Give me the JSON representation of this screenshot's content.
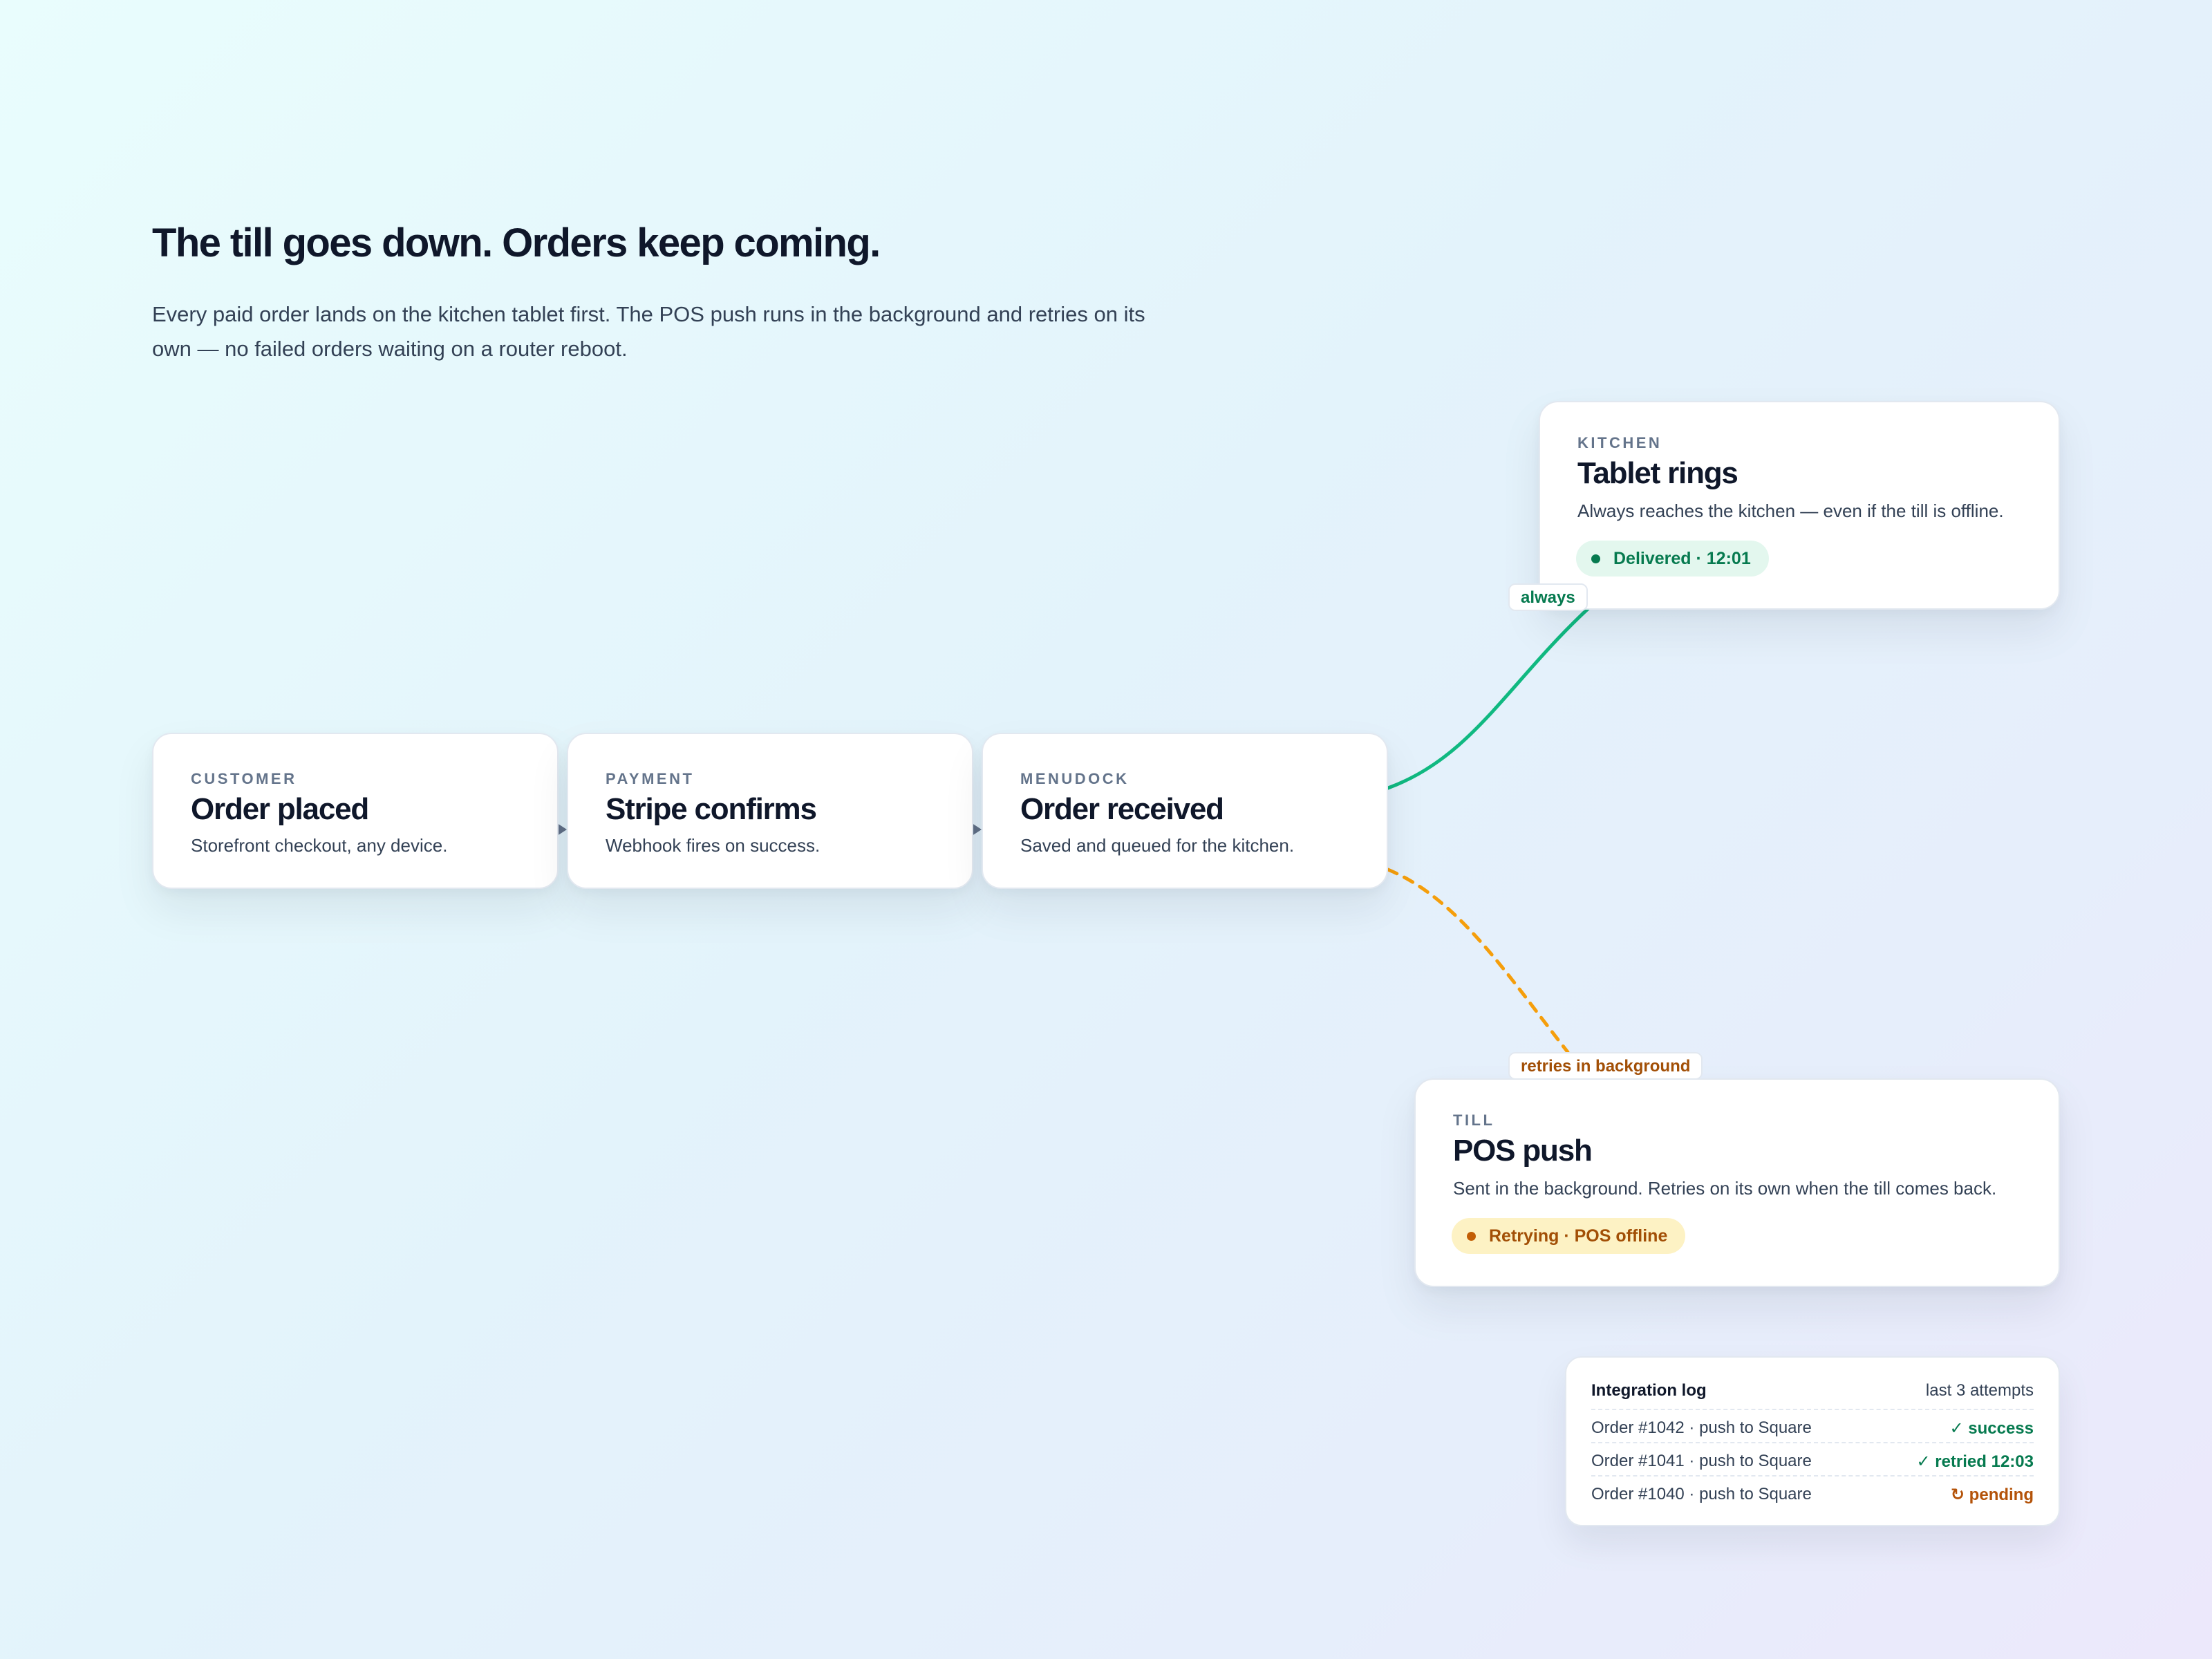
{
  "hero": {
    "headline": "The till goes down. Orders keep coming.",
    "subtext": "Every paid order lands on the kitchen tablet first. The POS push runs in the background and retries on its own — no failed orders waiting on a router reboot."
  },
  "steps": [
    {
      "eyebrow": "CUSTOMER",
      "title": "Order placed",
      "desc": "Storefront checkout, any device."
    },
    {
      "eyebrow": "PAYMENT",
      "title": "Stripe confirms",
      "desc": "Webhook fires on success."
    },
    {
      "eyebrow": "MENUDOCK",
      "title": "Order received",
      "desc": "Saved and queued for the kitchen."
    }
  ],
  "kitchen": {
    "eyebrow": "KITCHEN",
    "title": "Tablet rings",
    "desc": "Always reaches the kitchen — even if the till is offline.",
    "status": "Delivered · 12:01",
    "edge_label": "always"
  },
  "till": {
    "eyebrow": "TILL",
    "title": "POS push",
    "desc": "Sent in the background. Retries on its own when the till comes back.",
    "status": "Retrying · POS offline",
    "edge_label": "retries in background"
  },
  "log": {
    "title": "Integration log",
    "meta": "last 3 attempts",
    "rows": [
      {
        "label": "Order #1042 · push to Square",
        "status": "✓ success"
      },
      {
        "label": "Order #1041 · push to Square",
        "status": "✓ retried 12:03"
      },
      {
        "label": "Order #1040 · push to Square",
        "status": "↻ pending"
      }
    ]
  },
  "colors": {
    "success": "#10b981",
    "retry": "#f59e0b",
    "ink": "#0f172a"
  }
}
